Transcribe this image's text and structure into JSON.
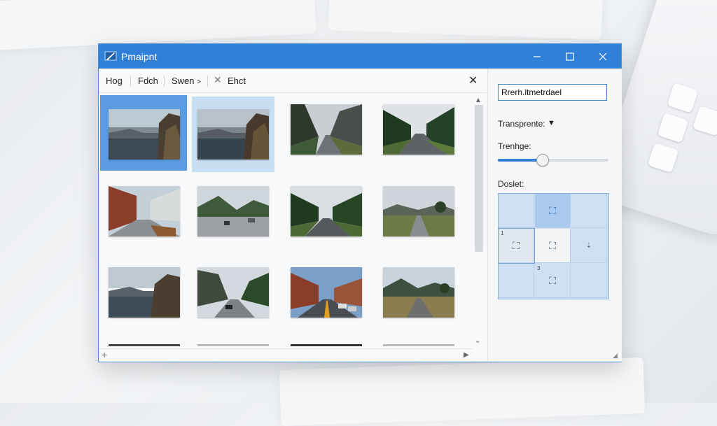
{
  "window": {
    "title": "Pmaipnt"
  },
  "toolbar": {
    "items": [
      "Hog",
      "Fdch",
      "Swen"
    ],
    "extra_label": "Ehct",
    "dropdown_glyph": "˃"
  },
  "thumbnails": [
    {
      "scene": "lake-cliff",
      "selected": "primary"
    },
    {
      "scene": "lake-cliff",
      "selected": "secondary"
    },
    {
      "scene": "canyon-road",
      "selected": "none"
    },
    {
      "scene": "forest-road",
      "selected": "none"
    },
    {
      "scene": "street-buildings",
      "selected": "none"
    },
    {
      "scene": "mountain-road",
      "selected": "none"
    },
    {
      "scene": "forest-road",
      "selected": "none"
    },
    {
      "scene": "valley-road",
      "selected": "none"
    },
    {
      "scene": "lake-cliff",
      "selected": "none"
    },
    {
      "scene": "mountain-road",
      "selected": "none"
    },
    {
      "scene": "street-buildings",
      "selected": "none"
    },
    {
      "scene": "valley-road",
      "selected": "none"
    }
  ],
  "panel": {
    "text_value": "Rrerh.ltmetrdael",
    "transparency_label": "Transprente:",
    "treshold_label": "Trenhge:",
    "slider_value_percent": 40,
    "position_label": "Doslet:",
    "anchor_labels": {
      "left_top": "1",
      "bottom_top": "3"
    }
  },
  "colors": {
    "accent": "#2f80d6",
    "selection": "#5a9be2",
    "selection_light": "#c9ddf3"
  }
}
